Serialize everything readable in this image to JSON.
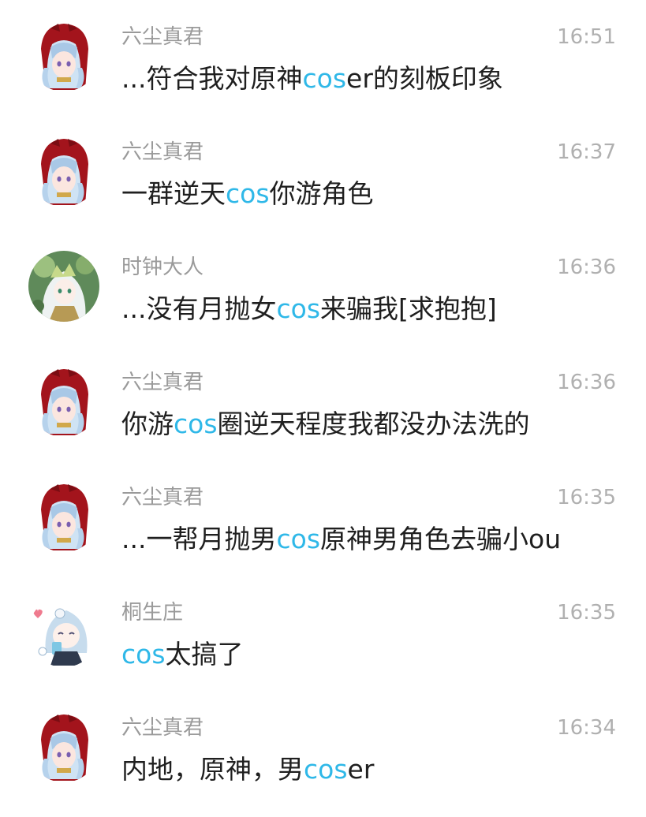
{
  "colors": {
    "highlight": "#2fb8e8",
    "name": "#9a9a9a",
    "time": "#b0b0b0",
    "text": "#1f1f1f"
  },
  "messages": [
    {
      "name": "六尘真君",
      "time": "16:51",
      "avatar": "red-hood-girl-avatar",
      "parts": [
        {
          "t": "...符合我对原神"
        },
        {
          "t": "cos",
          "hl": true
        },
        {
          "t": "er的刻板印象"
        }
      ]
    },
    {
      "name": "六尘真君",
      "time": "16:37",
      "avatar": "red-hood-girl-avatar",
      "parts": [
        {
          "t": "一群逆天"
        },
        {
          "t": "cos",
          "hl": true
        },
        {
          "t": "你游角色"
        }
      ]
    },
    {
      "name": "时钟大人",
      "time": "16:36",
      "avatar": "white-hair-green-ornament-avatar",
      "parts": [
        {
          "t": "...没有月抛女"
        },
        {
          "t": "cos",
          "hl": true
        },
        {
          "t": "来骗我[求抱抱]"
        }
      ]
    },
    {
      "name": "六尘真君",
      "time": "16:36",
      "avatar": "red-hood-girl-avatar",
      "parts": [
        {
          "t": "你游"
        },
        {
          "t": "cos",
          "hl": true
        },
        {
          "t": "圈逆天程度我都没办法洗的"
        }
      ]
    },
    {
      "name": "六尘真君",
      "time": "16:35",
      "avatar": "red-hood-girl-avatar",
      "parts": [
        {
          "t": "...一帮月抛男"
        },
        {
          "t": "cos",
          "hl": true
        },
        {
          "t": "原神男角色去骗小ou"
        }
      ]
    },
    {
      "name": "桐生庄",
      "time": "16:35",
      "avatar": "chibi-blue-hair-avatar",
      "parts": [
        {
          "t": "cos",
          "hl": true
        },
        {
          "t": "太搞了"
        }
      ]
    },
    {
      "name": "六尘真君",
      "time": "16:34",
      "avatar": "red-hood-girl-avatar",
      "parts": [
        {
          "t": "内地，原神，男"
        },
        {
          "t": "cos",
          "hl": true
        },
        {
          "t": "er"
        }
      ]
    }
  ]
}
